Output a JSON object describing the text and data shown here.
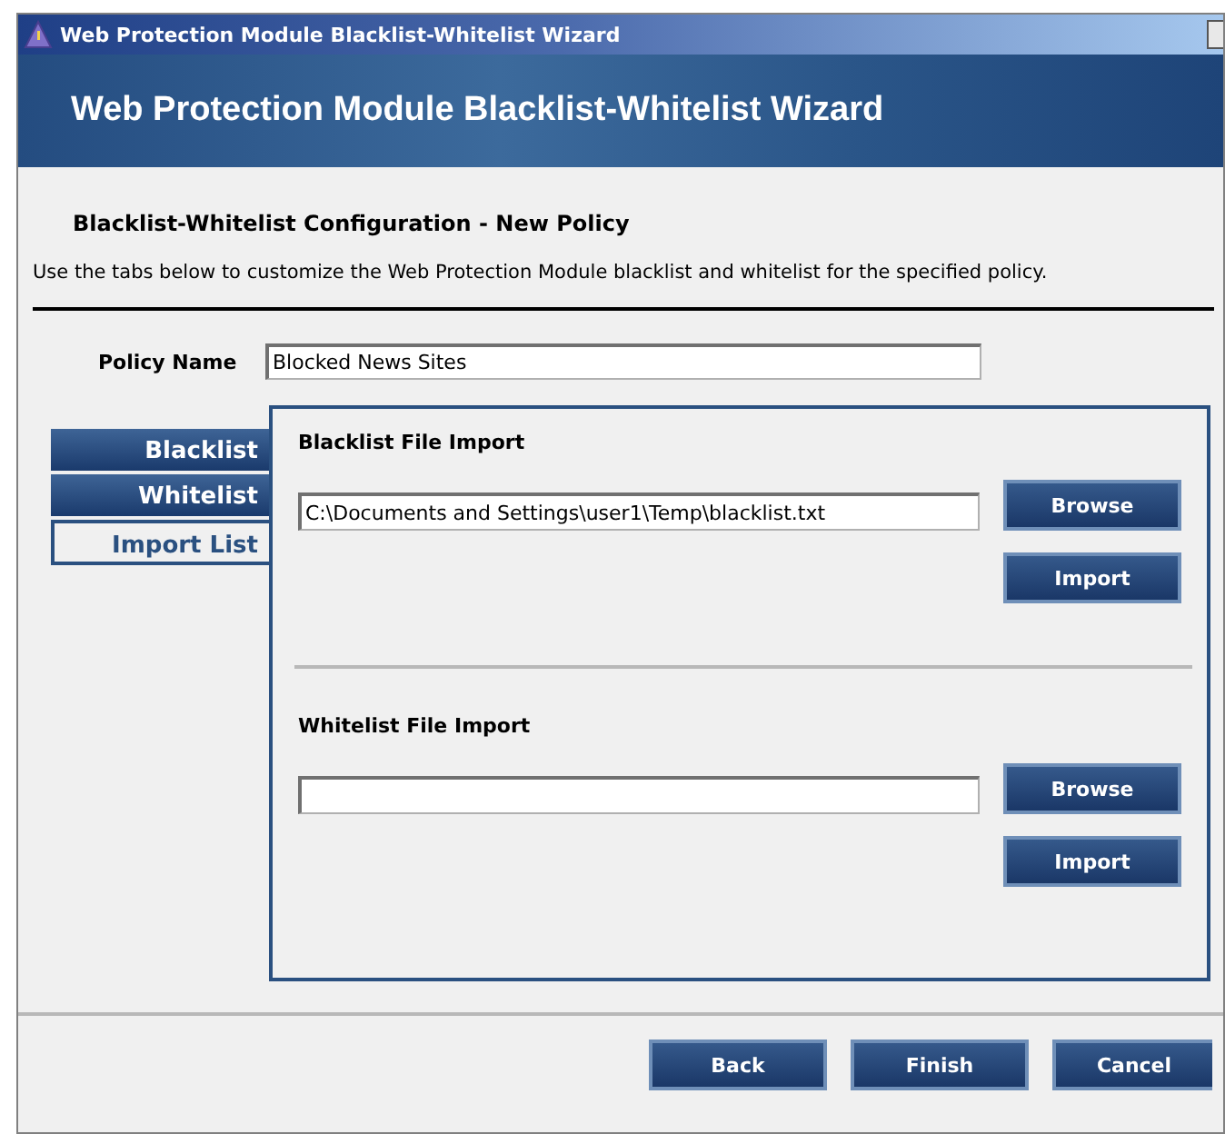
{
  "window": {
    "title": "Web Protection Module Blacklist-Whitelist Wizard"
  },
  "banner": {
    "title": "Web Protection Module Blacklist-Whitelist Wizard"
  },
  "heading": "Blacklist-Whitelist Configuration - New Policy",
  "description": "Use the tabs below to customize the Web Protection Module blacklist and whitelist for the specified policy.",
  "policy_name": {
    "label": "Policy Name",
    "value": "Blocked News Sites"
  },
  "tabs": [
    {
      "label": "Blacklist",
      "selected": false
    },
    {
      "label": "Whitelist",
      "selected": false
    },
    {
      "label": "Import List",
      "selected": true
    }
  ],
  "sections": [
    {
      "title": "Blacklist File Import",
      "value": "C:\\Documents and Settings\\user1\\Temp\\blacklist.txt",
      "buttons": [
        "Browse",
        "Import"
      ]
    },
    {
      "title": "Whitelist File Import",
      "buttons": [
        "Browse",
        "Import"
      ]
    }
  ],
  "buttons": [
    "Back",
    "Finish",
    "Cancel"
  ]
}
